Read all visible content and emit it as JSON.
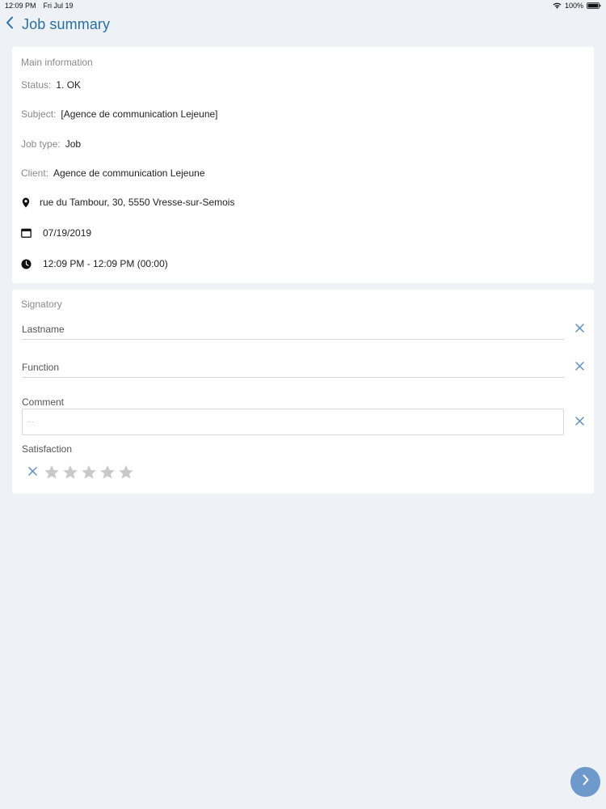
{
  "status_bar": {
    "time": "12:09 PM",
    "date": "Fri Jul 19",
    "battery": "100%"
  },
  "nav": {
    "title": "Job summary",
    "back_icon": "chevron-left-icon"
  },
  "main_info": {
    "heading": "Main information",
    "status": {
      "label": "Status",
      "value": "1. OK"
    },
    "subject": {
      "label": "Subject",
      "value": "[Agence de communication Lejeune]"
    },
    "job_type": {
      "label": "Job type",
      "value": "Job"
    },
    "client": {
      "label": "Client",
      "value": "Agence de communication Lejeune"
    },
    "address": "rue du Tambour, 30, 5550 Vresse-sur-Semois",
    "date": "07/19/2019",
    "time_range": "12:09 PM - 12:09 PM (00:00)"
  },
  "signatory": {
    "heading": "Signatory",
    "lastname_label": "Lastname",
    "function_label": "Function",
    "comment_label": "Comment",
    "comment_placeholder": "...",
    "satisfaction_label": "Satisfaction",
    "satisfaction_value": 0,
    "satisfaction_max": 5
  },
  "colors": {
    "accent": "#2a6fa3",
    "fab": "#6d9acb",
    "clear_icon": "#5f8fc0",
    "star_empty": "#c9c9c9"
  }
}
